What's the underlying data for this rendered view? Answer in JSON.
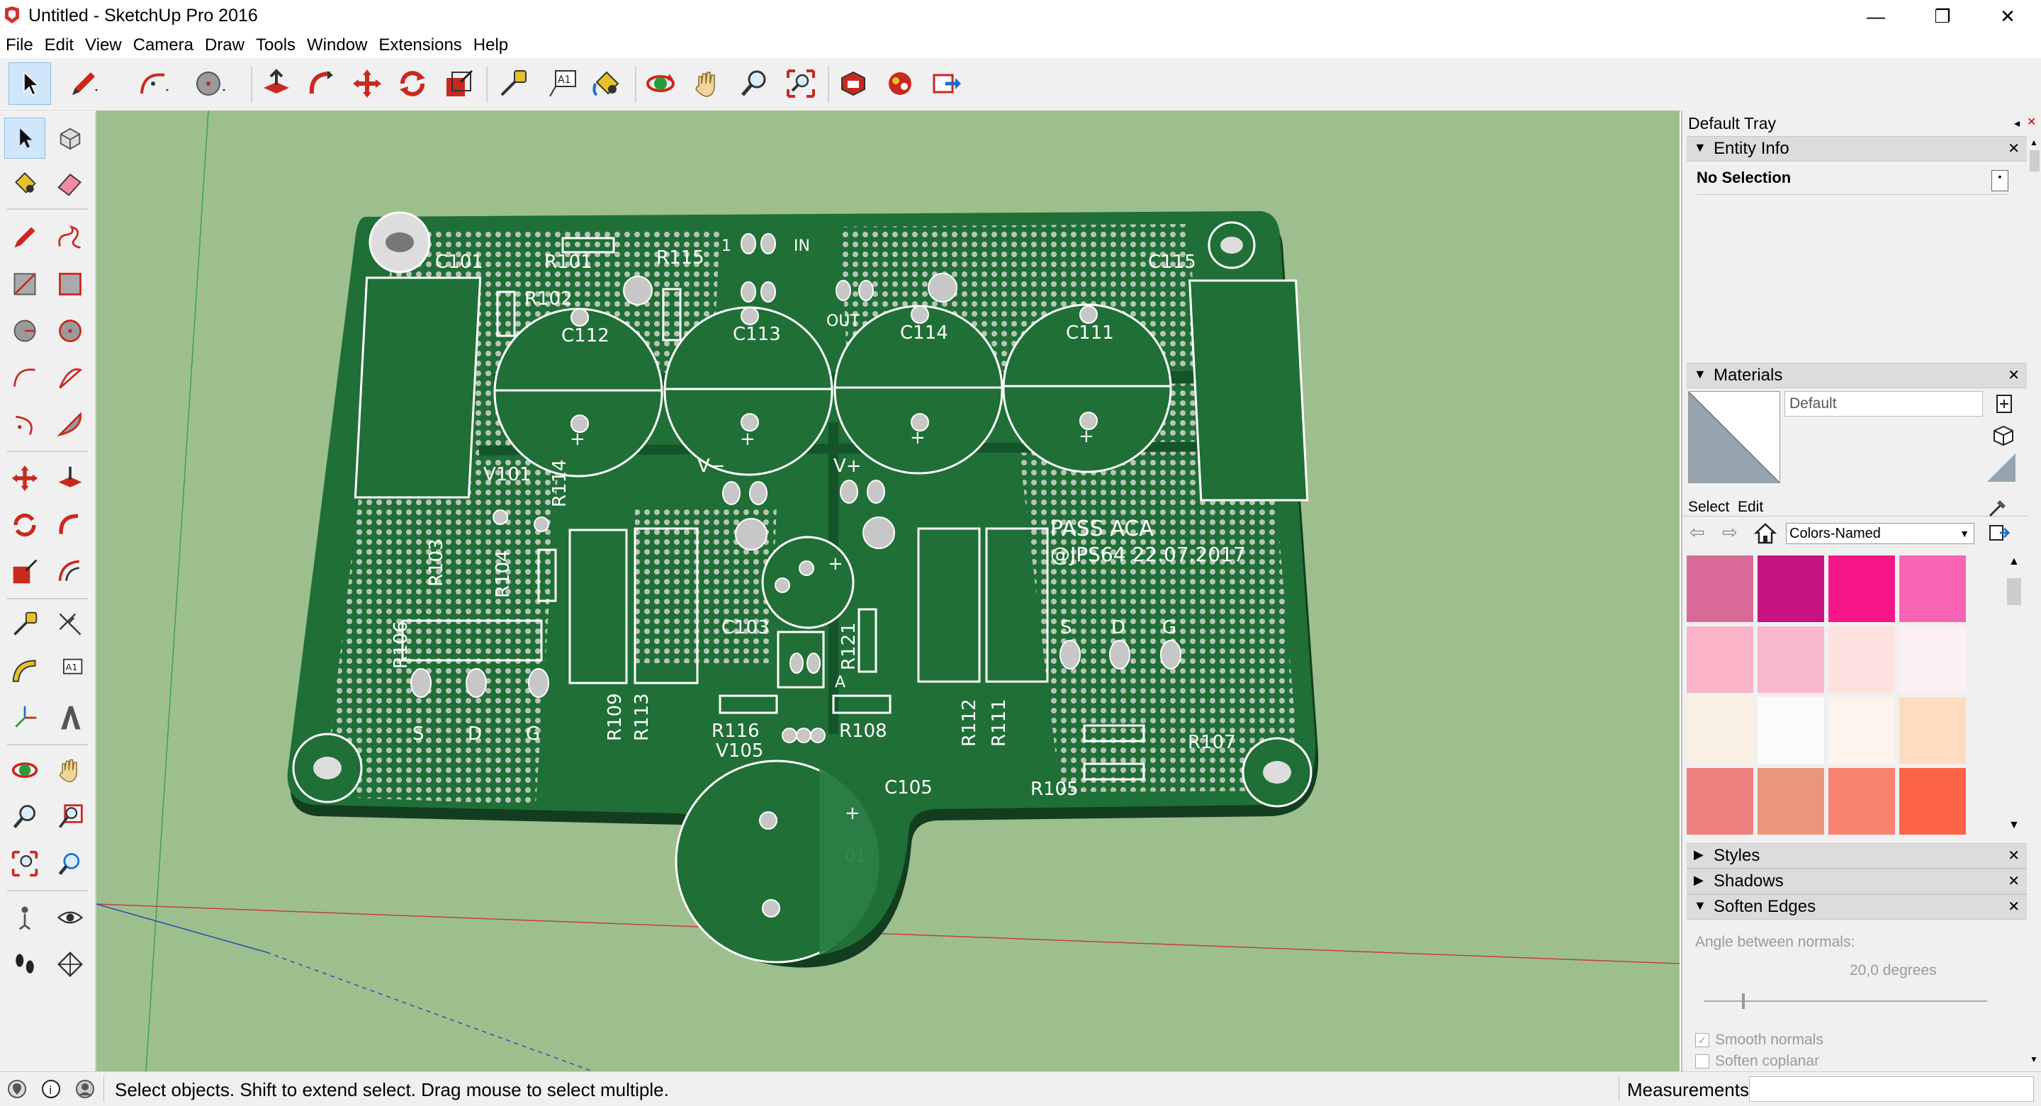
{
  "window": {
    "title": "Untitled - SketchUp Pro 2016",
    "minimize": "—",
    "restore": "❐",
    "close": "✕"
  },
  "menu": [
    "File",
    "Edit",
    "View",
    "Camera",
    "Draw",
    "Tools",
    "Window",
    "Extensions",
    "Help"
  ],
  "tray": {
    "title": "Default Tray",
    "entity_info": {
      "header": "Entity Info",
      "selection": "No Selection"
    },
    "materials": {
      "header": "Materials",
      "name_value": "Default",
      "tab_select": "Select",
      "tab_edit": "Edit",
      "library": "Colors-Named",
      "swatches": [
        "#d96a97",
        "#c7137f",
        "#f7168a",
        "#f864b3",
        "#fbb3c7",
        "#f9b9cd",
        "#fde1df",
        "#fdf0f2",
        "#f9efe3",
        "#fdfafa",
        "#fdf4ee",
        "#fedcbf",
        "#ef8080",
        "#e9967a",
        "#f98270",
        "#fd6347"
      ]
    },
    "styles": {
      "header": "Styles"
    },
    "shadows": {
      "header": "Shadows"
    },
    "soften_edges": {
      "header": "Soften Edges",
      "angle_label": "Angle between normals:",
      "angle_value": "20,0  degrees",
      "smooth_normals": "Smooth normals",
      "soften_coplanar": "Soften coplanar"
    }
  },
  "status": {
    "message": "Select objects. Shift to extend select. Drag mouse to select multiple.",
    "measurements_label": "Measurements",
    "measurements_value": ""
  },
  "pcb": {
    "labels": [
      "C101",
      "R101",
      "R115",
      "IN",
      "C115",
      "R102",
      "C112",
      "C113",
      "OUT",
      "C114",
      "C111",
      "V101",
      "R114",
      "V−",
      "V+",
      "R103",
      "R104",
      "C103",
      "PASS ACA",
      "@JPS64  22.07.2017",
      "R106",
      "R109",
      "R113",
      "R121",
      "R112",
      "R111",
      "S",
      "D",
      "G",
      "S",
      "D",
      "G",
      "R116",
      "R108",
      "V105",
      "R107",
      "C105",
      "R105",
      "A",
      "01",
      "1"
    ]
  },
  "colors": {
    "viewport": "#9dbf8e",
    "board": "#1f6f36",
    "board_dark": "#15542a",
    "silk": "#ffffff",
    "pad": "#b9b9b9"
  },
  "icons": {
    "select": "select-arrow-icon",
    "pencil": "pencil-icon",
    "eraser": "eraser-icon",
    "paint": "paint-bucket-icon"
  }
}
